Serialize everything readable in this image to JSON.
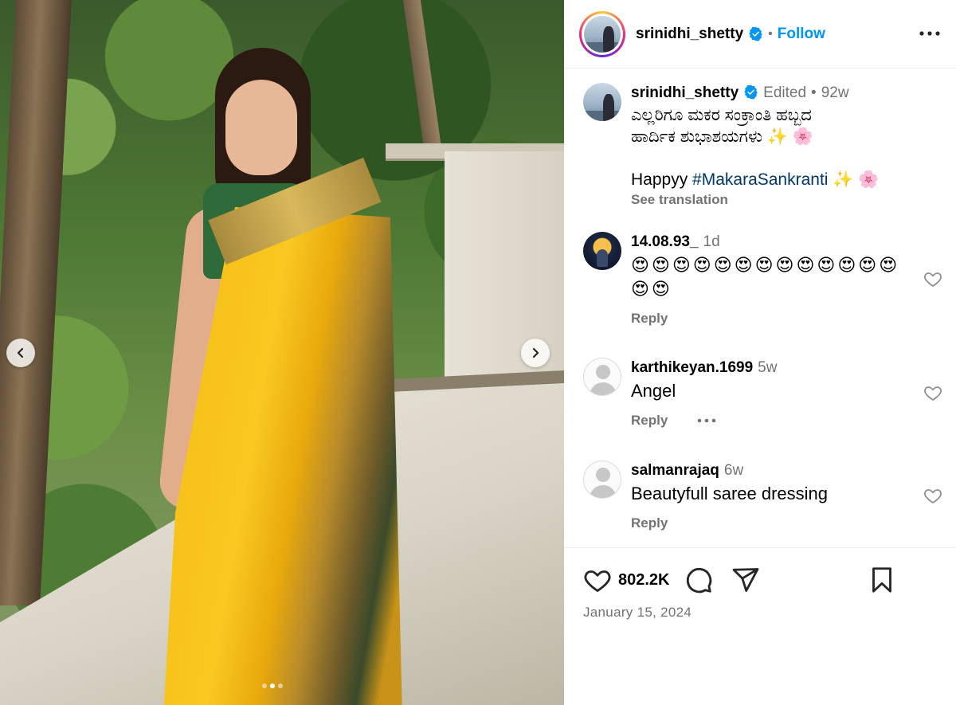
{
  "post": {
    "username": "srinidhi_shetty",
    "separator": "•",
    "follow_label": "Follow",
    "likes": "802.2K",
    "date": "January 15, 2024",
    "carousel": {
      "total": 3,
      "active_index": 1
    }
  },
  "caption": {
    "username": "srinidhi_shetty",
    "edited": "Edited",
    "separator": "•",
    "time": "92w",
    "line1": "ಎಲ್ಲರಿಗೂ ಮಕರ ಸಂಕ್ರಾಂತಿ ಹಬ್ಬದ",
    "line2": "ಹಾರ್ದಿಕ ಶುಭಾಶಯಗಳು ✨ 🌸",
    "happy_prefix": "Happyy ",
    "hashtag": "#MakaraSankranti",
    "happy_suffix": " ✨ 🌸",
    "see_translation": "See translation"
  },
  "comments": [
    {
      "username": "14.08.93_",
      "time": "1d",
      "text": "😍😍😍😍😍😍😍😍😍😍😍😍😍😍😍",
      "reply": "Reply"
    },
    {
      "username": "karthikeyan.1699",
      "time": "5w",
      "text": "Angel",
      "reply": "Reply"
    },
    {
      "username": "salmanrajaq",
      "time": "6w",
      "text": "Beautyfull saree dressing",
      "reply": "Reply"
    }
  ],
  "icons": {
    "verified": "verified-badge-icon",
    "more": "more-horizontal-icon",
    "like": "heart-icon",
    "comment": "comment-bubble-icon",
    "share": "paper-plane-icon",
    "save": "bookmark-icon",
    "prev": "chevron-left-icon",
    "next": "chevron-right-icon"
  },
  "colors": {
    "accent": "#0095f6",
    "secondary_text": "#737373",
    "hashtag": "#00376b",
    "verified": "#0095f6"
  }
}
